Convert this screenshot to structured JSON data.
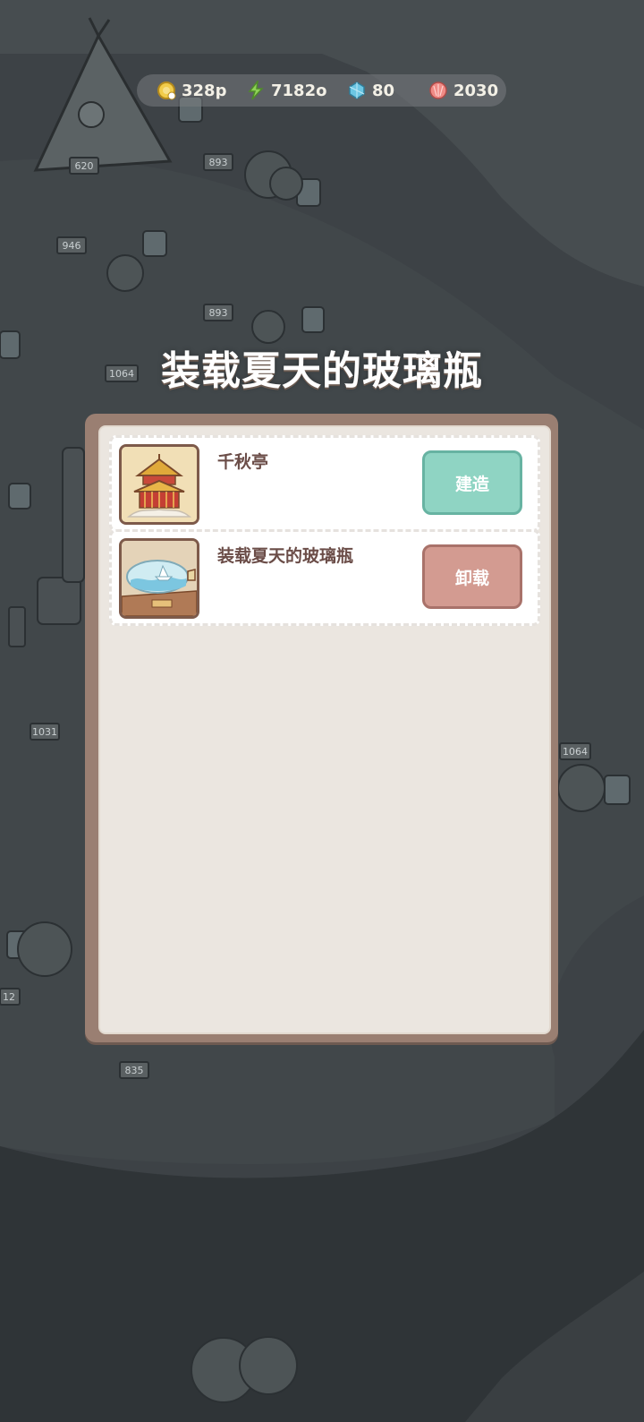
{
  "resources": [
    {
      "icon": "coin-icon",
      "value": "328p"
    },
    {
      "icon": "lightning-icon",
      "value": "7182o"
    },
    {
      "icon": "gem-icon",
      "value": "80"
    },
    {
      "icon": "shell-icon",
      "value": "2030"
    }
  ],
  "title": "装载夏天的玻璃瓶",
  "items": [
    {
      "name": "千秋亭",
      "action": "建造",
      "icon": "pavilion-icon"
    },
    {
      "name": "装载夏天的玻璃瓶",
      "action": "卸载",
      "icon": "glass-bottle-icon"
    }
  ],
  "scene_labels": [
    "620",
    "893",
    "946",
    "893",
    "1064",
    "1031",
    "1064",
    "835",
    "12"
  ],
  "colors": {
    "accent_build": "#8fd4c3",
    "accent_unload": "#d39b91",
    "panel_frame": "#9a7f72",
    "panel_bg": "#ebe6e0"
  }
}
